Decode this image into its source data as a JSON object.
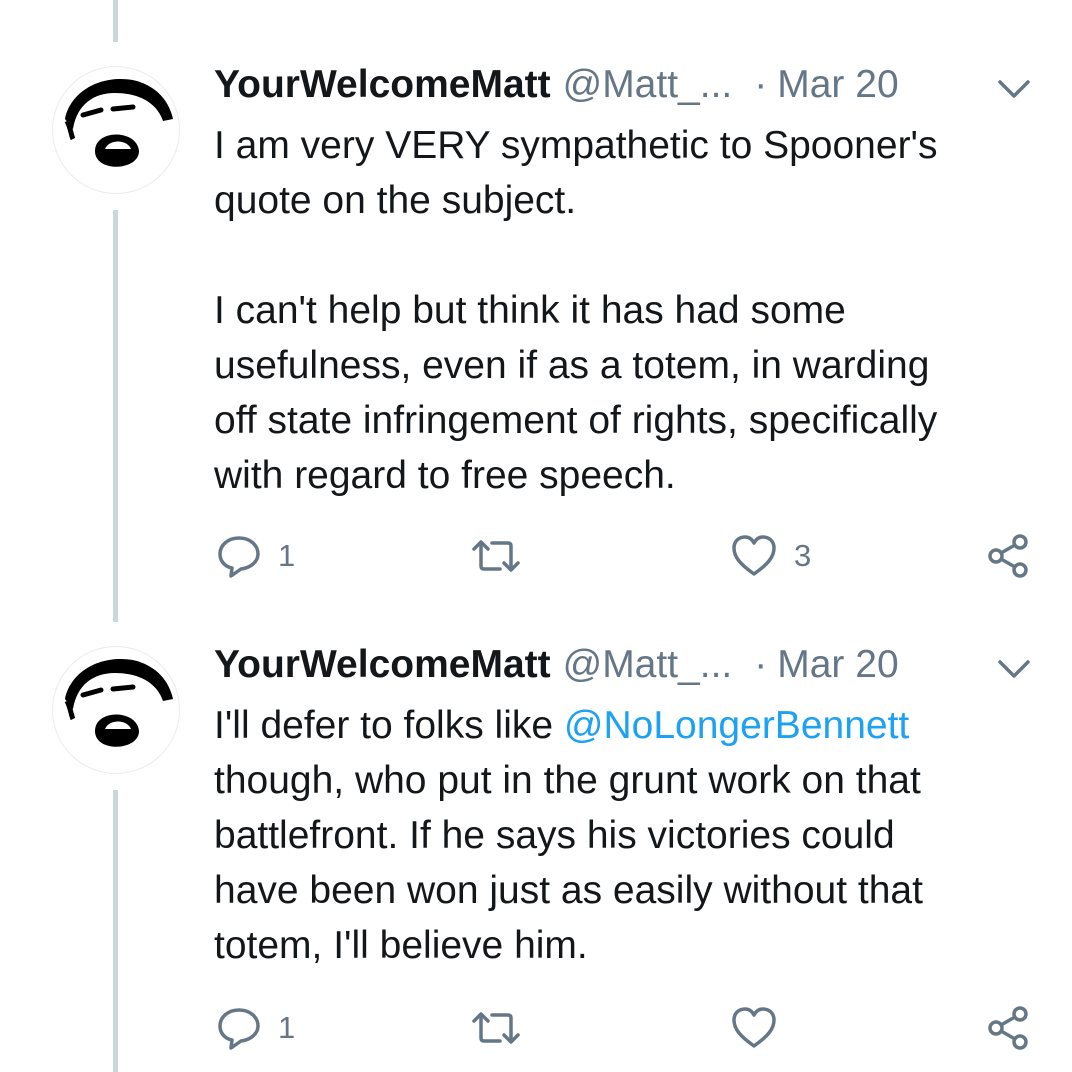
{
  "tweets": [
    {
      "author_name": "YourWelcomeMatt",
      "handle": "@Matt_...",
      "separator": "·",
      "date": "Mar 20",
      "body": [
        "I am very VERY sympathetic to Spooner's",
        "quote on the subject.",
        "",
        "I can't help but think it has had some",
        "usefulness, even if as a totem, in warding",
        "off state infringement of rights, specifically",
        "with regard to free speech."
      ],
      "reply_count": "1",
      "retweet_count": "",
      "like_count": "3"
    },
    {
      "author_name": "YourWelcomeMatt",
      "handle": "@Matt_...",
      "separator": "·",
      "date": "Mar 20",
      "body_line1_prefix": "I'll defer to folks like ",
      "mention": "@NoLongerBennett",
      "body": [
        "though, who put in the grunt work on that",
        "battlefront. If he says his victories could",
        "have been won just as easily without that",
        "totem, I'll believe him."
      ],
      "reply_count": "1",
      "retweet_count": "",
      "like_count": ""
    }
  ],
  "icons": [
    "chat-bubble-icon",
    "retweet-icon",
    "heart-icon",
    "share-icon",
    "chevron-down-icon"
  ],
  "colors": {
    "text": "#14171a",
    "secondary": "#657786",
    "mention": "#1da1f2",
    "thread_line": "#ccd6dd"
  }
}
